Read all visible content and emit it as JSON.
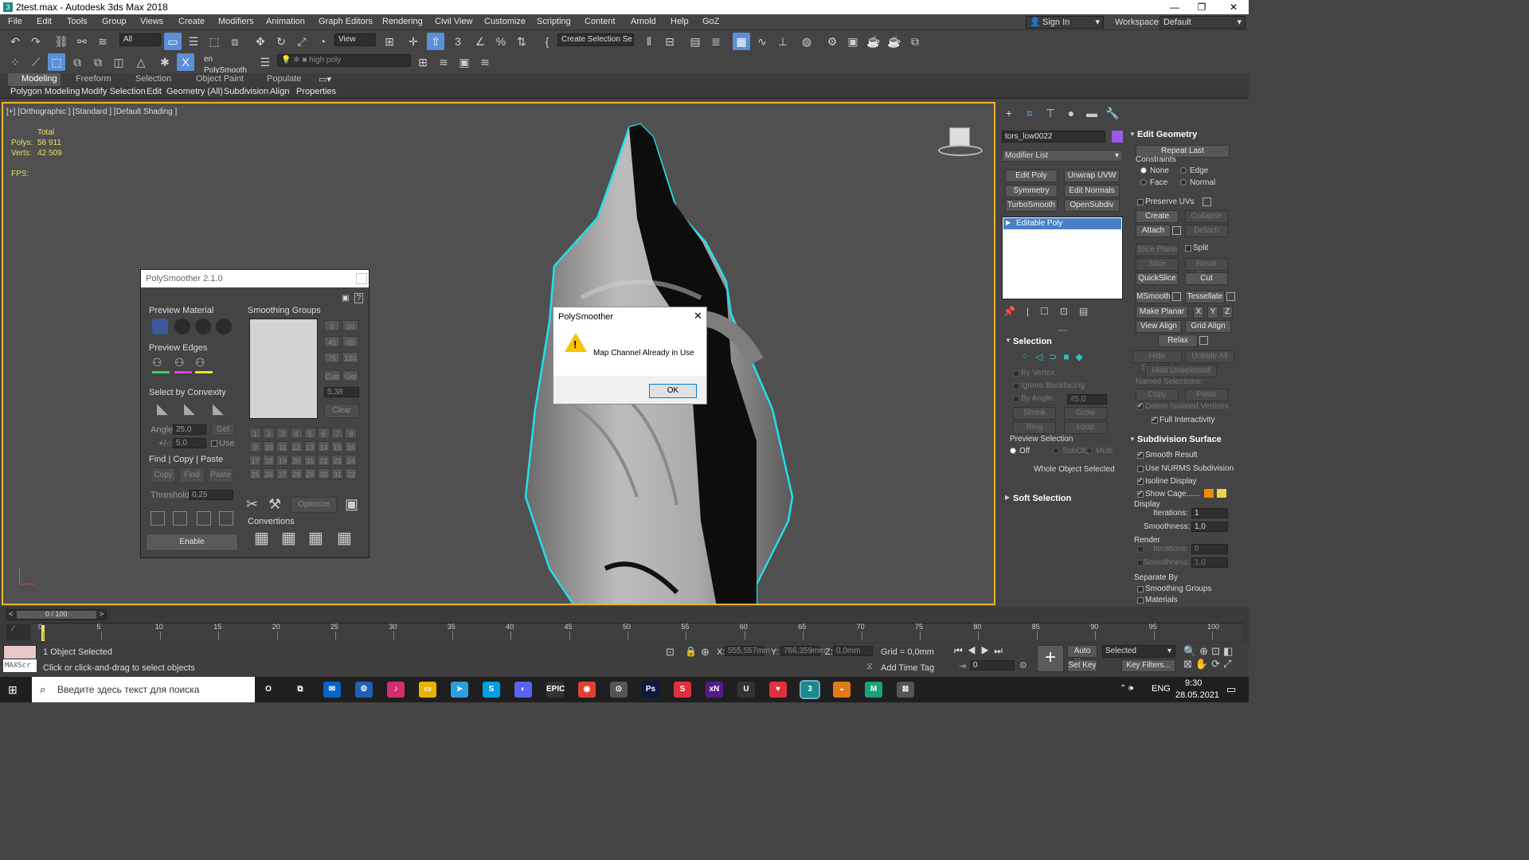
{
  "window": {
    "title": "2test.max - Autodesk 3ds Max 2018",
    "app_icon": "3"
  },
  "menu": [
    "File",
    "Edit",
    "Tools",
    "Group",
    "Views",
    "Create",
    "Modifiers",
    "Animation",
    "Graph Editors",
    "Rendering",
    "Civil View",
    "Customize",
    "Scripting",
    "Content",
    "Arnold",
    "Help",
    "GoZ"
  ],
  "signin": "Sign In",
  "workspaces": {
    "label": "Workspaces:",
    "value": "Default"
  },
  "toolbar": {
    "filter": "All",
    "view": "View",
    "selection_set": "Create Selection Se",
    "named_selection": "en PolySmooth",
    "layer": "high poly"
  },
  "ribbon": {
    "tabs": [
      "Modeling",
      "Freeform",
      "Selection",
      "Object Paint",
      "Populate"
    ],
    "sub": [
      "Polygon Modeling",
      "Modify Selection",
      "Edit",
      "Geometry (All)",
      "Subdivision",
      "Align",
      "Properties"
    ]
  },
  "viewport": {
    "label": "[+] [Orthographic ] [Standard ] [Default Shading ]",
    "stats": {
      "total": "Total",
      "polys_label": "Polys:",
      "polys": "56 911",
      "verts_label": "Verts:",
      "verts": "42 509",
      "fps": "FPS:"
    }
  },
  "polysmoother": {
    "title": "PolySmoother 2.1.0",
    "preview_material": "Preview Material",
    "preview_edges": "Preview Edges",
    "select_by_convexity": "Select by Convexity",
    "angle_label": "Angle:",
    "angle_value": "25,0",
    "pm_label": "+/-:",
    "pm_value": "5,0",
    "get": "Get",
    "use": "Use",
    "find_copy_paste": "Find | Copy | Paste",
    "copy": "Copy",
    "find": "Find",
    "paste": "Paste",
    "threshold_label": "Threshold:",
    "threshold_value": "0,25",
    "enable": "Enable",
    "smoothing_groups": "Smoothing Groups",
    "angle_buttons": [
      "0",
      "30",
      "45",
      "65",
      "75",
      "120"
    ],
    "cust": "Cust",
    "get2": "Get",
    "sg_value": "5,38",
    "clear": "Clear",
    "groups": [
      "1",
      "2",
      "3",
      "4",
      "5",
      "6",
      "7",
      "8",
      "9",
      "10",
      "11",
      "12",
      "13",
      "14",
      "15",
      "16",
      "17",
      "18",
      "19",
      "20",
      "21",
      "22",
      "23",
      "24",
      "25",
      "26",
      "27",
      "28",
      "29",
      "30",
      "31",
      "32"
    ],
    "optimize": "Optimize",
    "convertions": "Convertions"
  },
  "dialog": {
    "title": "PolySmoother",
    "message": "Map Channel Already in Use",
    "ok": "OK",
    "close": "✕"
  },
  "right_panel": {
    "object_name": "tors_low0022",
    "object_color": "#9b59e8",
    "modifier_list": "Modifier List",
    "mod_buttons": [
      "Edit Poly",
      "Unwrap UVW",
      "Symmetry",
      "Edit Normals",
      "TurboSmooth",
      "OpenSubdiv"
    ],
    "stack_item": "Editable Poly",
    "selection": {
      "title": "Selection",
      "by_vertex": "By Vertex",
      "ignore_backfacing": "Ignore Backfacing",
      "by_angle": "By Angle:",
      "by_angle_value": "45,0",
      "shrink": "Shrink",
      "grow": "Grow",
      "ring": "Ring",
      "loop": "Loop",
      "preview_selection": "Preview Selection",
      "off": "Off",
      "subobj": "SubObj",
      "multi": "Multi",
      "whole": "Whole Object Selected"
    },
    "soft_selection": "Soft Selection",
    "edit_geometry": {
      "title": "Edit Geometry",
      "repeat_last": "Repeat Last",
      "constraints": "Constraints",
      "none": "None",
      "edge": "Edge",
      "face": "Face",
      "normal": "Normal",
      "preserve_uvs": "Preserve UVs",
      "create": "Create",
      "collapse": "Collapse",
      "attach": "Attach",
      "detach": "Detach",
      "slice_plane": "Slice Plane",
      "split": "Split",
      "slice": "Slice",
      "reset_plane": "Reset Plane",
      "quickslice": "QuickSlice",
      "cut": "Cut",
      "msmooth": "MSmooth",
      "tessellate": "Tessellate",
      "make_planar": "Make Planar",
      "x": "X",
      "y": "Y",
      "z": "Z",
      "view_align": "View Align",
      "grid_align": "Grid Align",
      "relax": "Relax",
      "hide_selected": "Hide Selected",
      "unhide_all": "Unhide All",
      "hide_unselected": "Hide Unselected",
      "named_selections": "Named Selections:",
      "copy": "Copy",
      "paste": "Paste",
      "delete_isolated": "Delete Isolated Vertices",
      "full_interactivity": "Full Interactivity"
    },
    "subdivision": {
      "title": "Subdivision Surface",
      "smooth_result": "Smooth Result",
      "use_nurms": "Use NURMS Subdivision",
      "isoline": "Isoline Display",
      "show_cage": "Show Cage......",
      "cage_color1": "#f08c00",
      "cage_color2": "#e8d44a",
      "display": "Display",
      "iterations_label": "Iterations:",
      "iterations": "1",
      "smoothness_label": "Smoothness:",
      "smoothness": "1,0",
      "render": "Render",
      "r_iterations": "0",
      "r_smoothness": "1,0",
      "separate_by": "Separate By",
      "smoothing_groups": "Smoothing Groups",
      "materials": "Materials"
    }
  },
  "timeline": {
    "frame": "0 / 100",
    "ticks": [
      "0",
      "5",
      "10",
      "15",
      "20",
      "25",
      "30",
      "35",
      "40",
      "45",
      "50",
      "55",
      "60",
      "65",
      "70",
      "75",
      "80",
      "85",
      "90",
      "95",
      "100"
    ]
  },
  "status": {
    "maxscript": "MAXScr",
    "selected": "1 Object Selected",
    "prompt": "Click or click-and-drag to select objects",
    "x_label": "X:",
    "x": "555,557mm",
    "y_label": "Y:",
    "y": "766,359mm",
    "z_label": "Z:",
    "z": "0,0mm",
    "grid": "Grid = 0,0mm",
    "add_time_tag": "Add Time Tag",
    "auto_key": "Auto Key",
    "set_key": "Set Key",
    "key_mode": "Selected",
    "key_filters": "Key Filters...",
    "frame_value": "0"
  },
  "taskbar": {
    "search": "Введите здесь текст для поиска",
    "lang": "ENG",
    "time": "9:30",
    "date": "28.05.2021",
    "apps": [
      "O",
      "⧉",
      "✉",
      "⚙",
      "♪",
      "▭",
      "➤",
      "S",
      "◐",
      "EPIC",
      "◉",
      "⊙",
      "Ps",
      "S",
      "xN",
      "U",
      "♥",
      "3",
      "◒",
      "M",
      "⊠"
    ]
  }
}
